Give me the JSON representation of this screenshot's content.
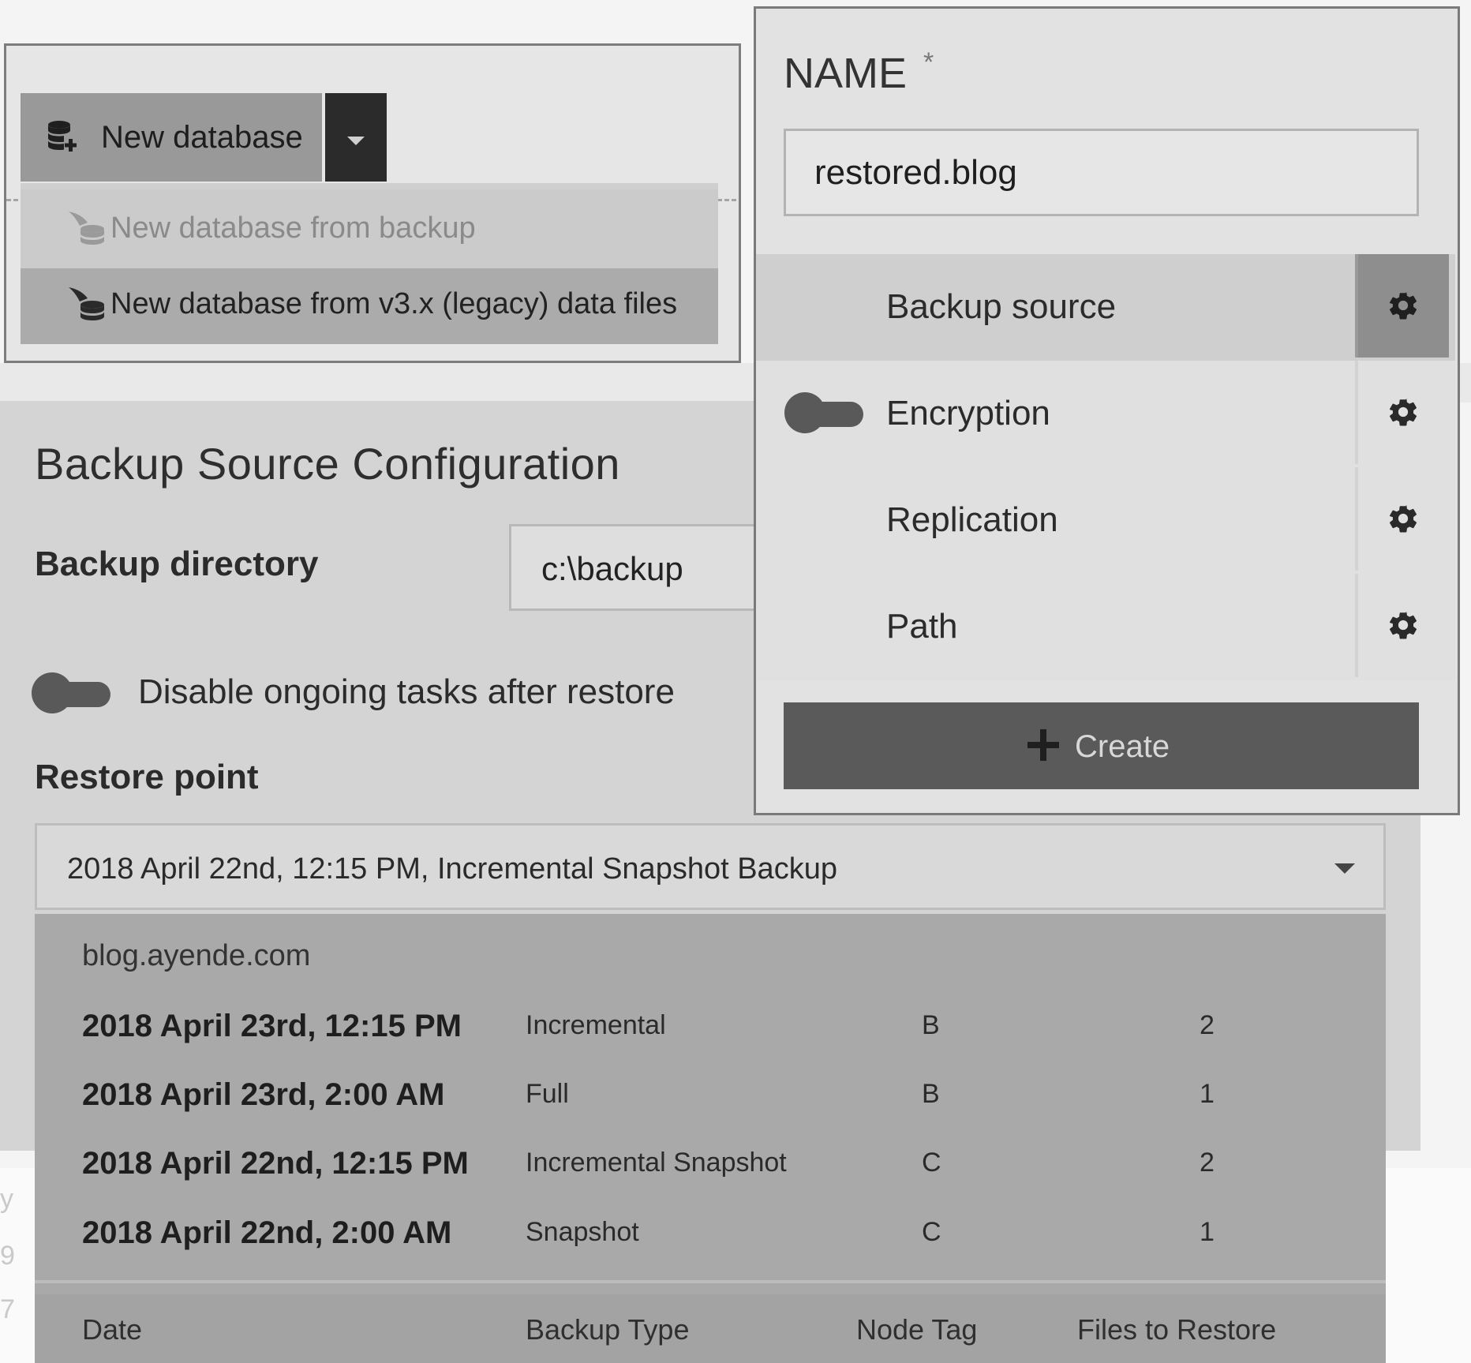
{
  "new_database": {
    "button_label": "New database",
    "menu": [
      {
        "label": "New database from backup",
        "state": "disabled"
      },
      {
        "label": "New database from v3.x (legacy) data files",
        "state": "hover"
      }
    ]
  },
  "backup_source_config": {
    "title": "Backup Source Configuration",
    "backup_directory_label": "Backup directory",
    "backup_directory_value": "c:\\backup",
    "disable_tasks_label": "Disable ongoing tasks after restore",
    "disable_tasks_enabled": false,
    "restore_point_label": "Restore point",
    "restore_point_selected": "2018 April 22nd, 12:15 PM, Incremental Snapshot Backup",
    "restore_points_group": "blog.ayende.com",
    "restore_points": [
      {
        "date": "2018 April 23rd, 12:15 PM",
        "type": "Incremental",
        "node": "B",
        "files": "2"
      },
      {
        "date": "2018 April 23rd, 2:00 AM",
        "type": "Full",
        "node": "B",
        "files": "1"
      },
      {
        "date": "2018 April 22nd, 12:15 PM",
        "type": "Incremental Snapshot",
        "node": "C",
        "files": "2"
      },
      {
        "date": "2018 April 22nd, 2:00 AM",
        "type": "Snapshot",
        "node": "C",
        "files": "1"
      }
    ],
    "columns": {
      "date": "Date",
      "type": "Backup Type",
      "node": "Node Tag",
      "files": "Files to Restore"
    }
  },
  "create_panel": {
    "name_label": "NAME",
    "required_mark": "*",
    "name_value": "restored.blog",
    "sections": [
      {
        "label": "Backup source",
        "active": true
      },
      {
        "label": "Encryption",
        "active": false,
        "toggle": true
      },
      {
        "label": "Replication",
        "active": false
      },
      {
        "label": "Path",
        "active": false
      }
    ],
    "create_label": "Create"
  },
  "icons": {
    "database_add": "database-plus-icon",
    "legacy": "legacy-database-icon",
    "gear": "gear-icon",
    "plus": "plus-icon",
    "caret": "caret-down-icon"
  },
  "colors": {
    "dark_button": "#2b2b2b",
    "create_button": "#5a5a5a",
    "dropdown_bg": "#a9a9a9"
  }
}
